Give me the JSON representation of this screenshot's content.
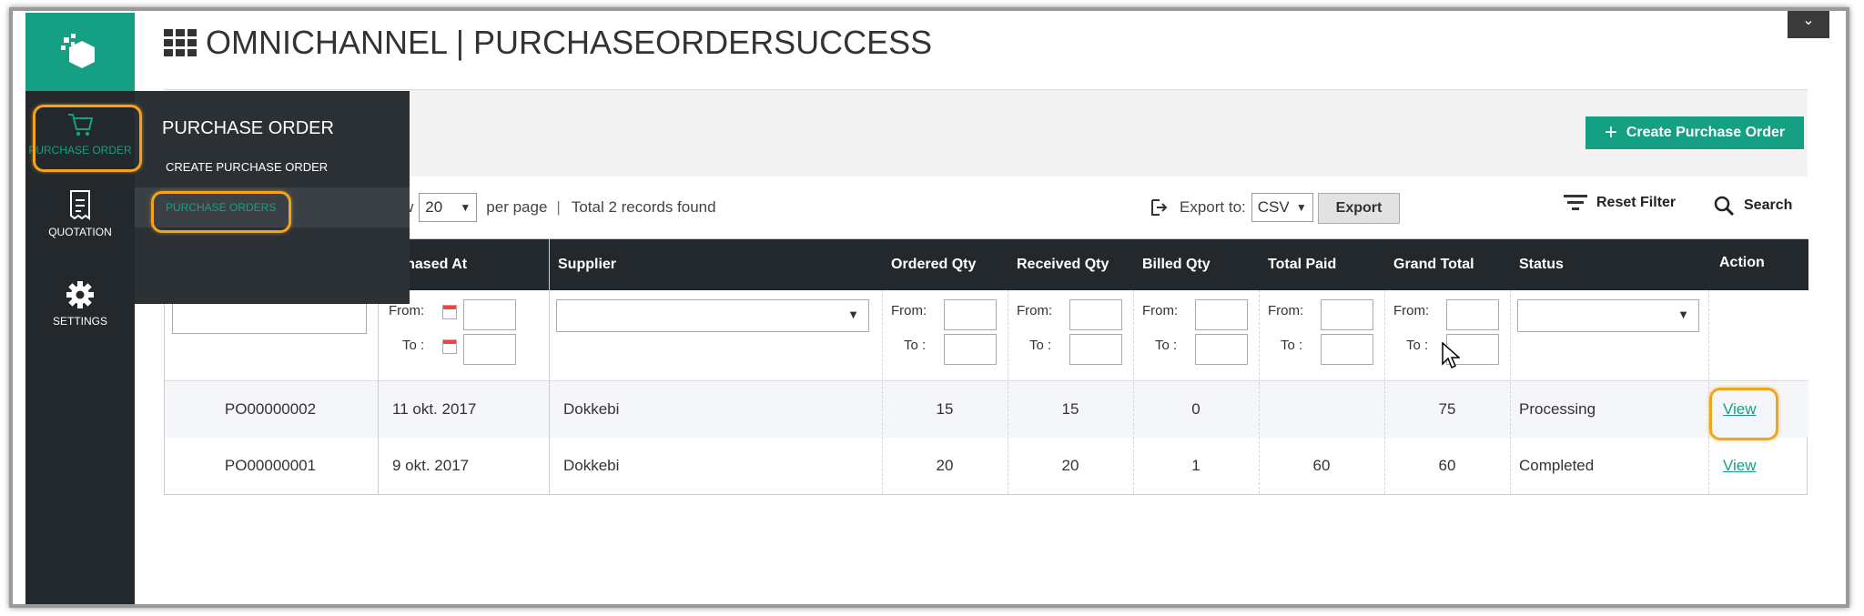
{
  "header": {
    "title": "OMNICHANNEL | PURCHASEORDERSUCCESS",
    "create_button": "Create Purchase Order",
    "collapse_icon": "chevron-down-icon"
  },
  "sidebar": {
    "items": [
      {
        "label": "PURCHASE ORDER",
        "icon": "cart-icon",
        "active": true
      },
      {
        "label": "QUOTATION",
        "icon": "receipt-icon",
        "active": false
      },
      {
        "label": "SETTINGS",
        "icon": "gear-icon",
        "active": false
      }
    ]
  },
  "flyout": {
    "title": "PURCHASE ORDER",
    "items": [
      "CREATE PURCHASE ORDER",
      "PURCHASE ORDERS"
    ]
  },
  "toolbar": {
    "view_suffix": "w",
    "per_page_value": "20",
    "per_page_label": "per page",
    "separator": "|",
    "records": "Total 2 records found",
    "export_label": "Export to:",
    "export_format": "CSV",
    "export_button": "Export",
    "reset_filter": "Reset Filter",
    "search": "Search"
  },
  "grid": {
    "columns": [
      "rchased At",
      "Supplier",
      "Ordered Qty",
      "Received Qty",
      "Billed Qty",
      "Total Paid",
      "Grand Total",
      "Status",
      "Action"
    ],
    "filter_from": "From:",
    "filter_to": "To :",
    "rows": [
      {
        "po": "PO00000002",
        "purchased": "11 okt. 2017",
        "supplier": "Dokkebi",
        "ordered": "15",
        "received": "15",
        "billed": "0",
        "paid": "",
        "grand": "75",
        "status": "Processing",
        "action": "View"
      },
      {
        "po": "PO00000001",
        "purchased": "9 okt. 2017",
        "supplier": "Dokkebi",
        "ordered": "20",
        "received": "20",
        "billed": "1",
        "paid": "60",
        "grand": "60",
        "status": "Completed",
        "action": "View"
      }
    ]
  },
  "colors": {
    "accent": "#15a084",
    "sidebar": "#23282d",
    "highlight": "#f2a51a"
  }
}
